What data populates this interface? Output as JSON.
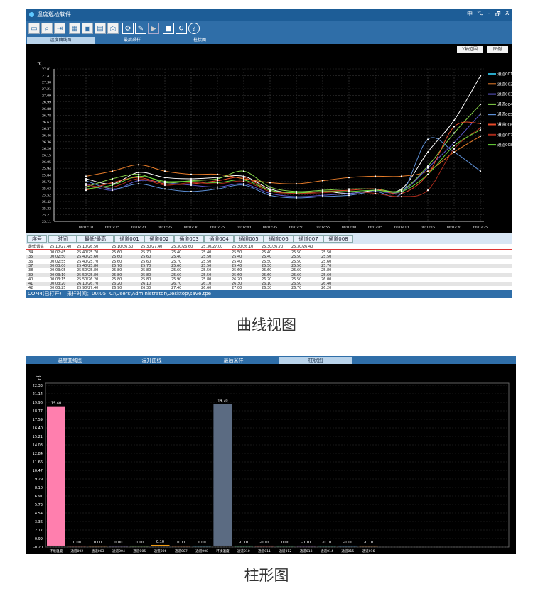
{
  "window": {
    "title": "温度巡检软件",
    "controls": [
      "中",
      "℃",
      "–",
      "🗗",
      "X"
    ]
  },
  "toolbar_icons": [
    "open-folder-icon",
    "search-icon",
    "export-icon",
    "excel-icon",
    "save-icon",
    "save-as-icon",
    "print-icon",
    "gear-icon",
    "wrench-icon",
    "play-icon",
    "stop-icon",
    "refresh-icon",
    "help-icon"
  ],
  "tabs_top": [
    "温度曲线图",
    "最后采样",
    "柱状图"
  ],
  "curve": {
    "unit": "℃",
    "y_ticks": [
      "27.01",
      "27.41",
      "27.30",
      "27.21",
      "27.09",
      "26.99",
      "26.88",
      "26.78",
      "26.67",
      "26.57",
      "26.46",
      "26.36",
      "26.26",
      "26.15",
      "26.05",
      "25.94",
      "25.84",
      "25.73",
      "25.63",
      "25.52",
      "25.42",
      "25.32",
      "25.21",
      "25.11"
    ],
    "x_ticks": [
      "00:02:10",
      "00:02:15",
      "00:02:20",
      "00:02:25",
      "00:02:30",
      "00:02:35",
      "00:02:40",
      "00:02:45",
      "00:02:50",
      "00:02:55",
      "00:03:00",
      "00:03:05",
      "00:03:10",
      "00:03:15",
      "00:03:20",
      "00:03:25"
    ],
    "y_range_button": "Y轴范围",
    "legend_button": "图例",
    "legend": [
      {
        "name": "通道001",
        "color": "#2aa8c8"
      },
      {
        "name": "通道002",
        "color": "#e87d2a"
      },
      {
        "name": "通道003",
        "color": "#5a56c8"
      },
      {
        "name": "通道004",
        "color": "#86d44a"
      },
      {
        "name": "通道005",
        "color": "#5d8fd6"
      },
      {
        "name": "通道006",
        "color": "#e84a2a"
      },
      {
        "name": "通道007",
        "color": "#a82a1a"
      },
      {
        "name": "通道008",
        "color": "#6bd83a"
      }
    ],
    "chart_data": {
      "type": "line",
      "x": [
        "00:02:10",
        "00:02:15",
        "00:02:20",
        "00:02:25",
        "00:02:30",
        "00:02:35",
        "00:02:40",
        "00:02:45",
        "00:02:50",
        "00:02:55",
        "00:03:00",
        "00:03:05",
        "00:03:10",
        "00:03:15",
        "00:03:20",
        "00:03:25"
      ],
      "ylim": [
        25.11,
        27.51
      ],
      "series": [
        {
          "name": "通道001",
          "color": "#ffffff",
          "values": [
            25.78,
            25.7,
            25.88,
            25.8,
            25.78,
            25.8,
            25.82,
            25.62,
            25.55,
            25.58,
            25.55,
            25.6,
            25.62,
            26.2,
            26.7,
            27.4
          ]
        },
        {
          "name": "通道002",
          "color": "#e87d2a",
          "values": [
            25.82,
            25.9,
            26.0,
            25.9,
            25.85,
            25.85,
            25.78,
            25.72,
            25.7,
            25.75,
            25.8,
            25.82,
            25.82,
            25.9,
            26.2,
            26.45
          ]
        },
        {
          "name": "通道003",
          "color": "#5a56c8",
          "values": [
            25.7,
            25.6,
            25.75,
            25.72,
            25.68,
            25.65,
            25.7,
            25.55,
            25.5,
            25.52,
            25.55,
            25.58,
            25.58,
            25.95,
            26.35,
            26.8
          ]
        },
        {
          "name": "通道004",
          "color": "#86d44a",
          "values": [
            25.65,
            25.78,
            25.85,
            25.72,
            25.75,
            25.78,
            25.9,
            25.65,
            25.58,
            25.6,
            25.62,
            25.62,
            25.6,
            25.98,
            26.5,
            26.95
          ]
        },
        {
          "name": "通道005",
          "color": "#5d8fd6",
          "values": [
            25.75,
            25.62,
            25.7,
            25.62,
            25.58,
            25.62,
            25.68,
            25.52,
            25.48,
            25.5,
            25.52,
            25.58,
            25.55,
            26.4,
            26.2,
            25.9
          ]
        },
        {
          "name": "通道006",
          "color": "#e84a2a",
          "values": [
            25.6,
            25.72,
            25.8,
            25.7,
            25.7,
            25.75,
            25.8,
            25.6,
            25.55,
            25.58,
            25.6,
            25.62,
            25.55,
            25.85,
            26.6,
            26.65
          ]
        },
        {
          "name": "通道007",
          "color": "#a82a1a",
          "values": [
            25.68,
            25.65,
            25.78,
            25.68,
            25.72,
            25.7,
            25.74,
            25.58,
            25.55,
            25.56,
            25.58,
            25.55,
            25.5,
            25.6,
            26.25,
            26.58
          ]
        },
        {
          "name": "通道008",
          "color": "#6bd83a",
          "values": [
            25.62,
            25.68,
            25.82,
            25.74,
            25.74,
            25.72,
            25.76,
            25.6,
            25.56,
            25.58,
            25.58,
            25.6,
            25.58,
            25.85,
            26.3,
            26.55
          ]
        }
      ]
    }
  },
  "table": {
    "headers": [
      "序号",
      "时间",
      "最低/最高",
      "通道001",
      "通道002",
      "通道003",
      "通道004",
      "通道005",
      "通道006",
      "通道007",
      "通道008"
    ],
    "limit_row": [
      "最低/最高",
      "",
      "25.10/27.40",
      "25.10/26.50",
      "25.10/26.50",
      "25.30/27.40",
      "25.30/26.60",
      "25.30/27.00",
      "25.30/26.10",
      "25.30/26.70",
      "25.30/26.40"
    ],
    "rows": [
      [
        "34",
        "00:02:45",
        "25.40/25.70",
        "25.60",
        "25.70",
        "25.40",
        "25.40",
        "25.50",
        "25.40",
        "25.50",
        "25.50"
      ],
      [
        "35",
        "00:02:50",
        "25.40/25.60",
        "25.60",
        "25.60",
        "25.40",
        "25.50",
        "25.40",
        "25.40",
        "25.50",
        "25.50"
      ],
      [
        "36",
        "00:02:55",
        "25.40/25.70",
        "25.60",
        "25.60",
        "25.70",
        "25.50",
        "25.40",
        "25.50",
        "25.50",
        "25.60"
      ],
      [
        "37",
        "00:03:00",
        "25.40/25.80",
        "25.70",
        "25.70",
        "25.60",
        "25.50",
        "25.40",
        "25.50",
        "25.50",
        "25.70"
      ],
      [
        "38",
        "00:03:05",
        "25.50/25.80",
        "25.80",
        "25.80",
        "25.60",
        "25.50",
        "25.60",
        "25.60",
        "25.60",
        "25.80"
      ],
      [
        "39",
        "00:03:10",
        "25.50/25.80",
        "25.80",
        "25.80",
        "25.60",
        "25.50",
        "25.60",
        "25.60",
        "25.60",
        "25.60"
      ],
      [
        "40",
        "00:03:15",
        "25.50/26.20",
        "25.80",
        "25.80",
        "25.90",
        "25.80",
        "26.20",
        "26.20",
        "25.50",
        "26.00"
      ],
      [
        "41",
        "00:03:20",
        "26.10/26.70",
        "26.20",
        "26.10",
        "26.70",
        "26.10",
        "26.30",
        "26.10",
        "26.50",
        "26.40"
      ],
      [
        "42",
        "00:03:25",
        "25.90/27.40",
        "26.90",
        "26.30",
        "27.40",
        "26.60",
        "27.00",
        "26.30",
        "26.70",
        "26.20"
      ]
    ]
  },
  "status": {
    "port": "COM4(已打开)",
    "sample_label": "采样时间：00:05",
    "file_path": "C:\\Users\\Administrator\\Desktop\\save.tpe"
  },
  "captions": {
    "curve": "曲线视图",
    "bar": "柱形图"
  },
  "tabs_bottom": [
    "温度曲线图",
    "温升曲线",
    "最后采样",
    "柱状图"
  ],
  "bar": {
    "unit": "℃",
    "y_ticks": [
      "22.33",
      "21.14",
      "19.96",
      "18.77",
      "17.59",
      "16.40",
      "15.21",
      "14.03",
      "12.84",
      "11.66",
      "10.47",
      "9.29",
      "8.10",
      "6.91",
      "5.73",
      "4.54",
      "3.36",
      "2.17",
      "0.99",
      "-0.20"
    ],
    "chart_data": {
      "type": "bar",
      "categories": [
        "环境温度",
        "通道002",
        "通道003",
        "通道004",
        "通道005",
        "通道006",
        "通道007",
        "通道008",
        "环境温度",
        "通道010",
        "通道011",
        "通道012",
        "通道013",
        "通道014",
        "通道015",
        "通道016"
      ],
      "values": [
        19.4,
        0.0,
        0.0,
        0.0,
        0.0,
        0.1,
        0.0,
        0.0,
        19.7,
        -0.1,
        -0.1,
        0.0,
        -0.1,
        -0.1,
        -0.1,
        -0.1
      ],
      "value_labels": [
        "19.40",
        "0.00",
        "0.00",
        "0.00",
        "0.00",
        "0.10",
        "0.00",
        "0.00",
        "19.70",
        "-0.10",
        "-0.10",
        "0.00",
        "-0.10",
        "-0.10",
        "-0.10",
        "-0.10"
      ],
      "colors": [
        "#ff7fae",
        "#c0392b",
        "#e67e22",
        "#7d5cb5",
        "#6fbf40",
        "#f39c12",
        "#d35400",
        "#2aa8c8",
        "#5b6b82",
        "#2ecc71",
        "#e74c3c",
        "#27ae60",
        "#8e44ad",
        "#16a085",
        "#3498db",
        "#e67e22"
      ],
      "ylim": [
        -0.2,
        22.33
      ]
    }
  }
}
